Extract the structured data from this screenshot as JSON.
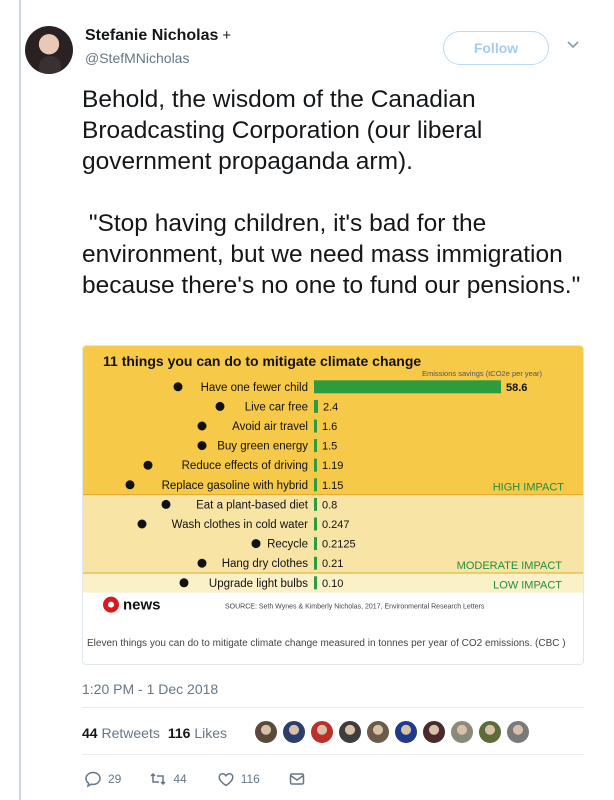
{
  "author": {
    "name": "Stefanie Nicholas",
    "name_symbol": "+",
    "handle": "@StefMNicholas"
  },
  "follow_label": "Follow",
  "tweet_text": "Behold, the wisdom of the Canadian Broadcasting Corporation (our liberal government propaganda arm).\n\n \"Stop having children, it's bad for the environment, but we need mass immigration because there's no one to fund our pensions.\"",
  "chart_data": {
    "type": "bar",
    "title": "11 things you can do to mitigate climate change",
    "subtitle": "Emissions savings (tCO2e per year)",
    "categories": [
      "Have one fewer child",
      "Live car free",
      "Avoid air travel",
      "Buy green energy",
      "Reduce effects of driving",
      "Replace gasoline with hybrid",
      "Eat a plant-based diet",
      "Wash clothes in cold water",
      "Recycle",
      "Hang dry clothes",
      "Upgrade light bulbs"
    ],
    "values": [
      58.6,
      2.4,
      1.6,
      1.5,
      1.19,
      1.15,
      0.8,
      0.247,
      0.2125,
      0.21,
      0.1
    ],
    "value_labels": [
      "58.6",
      "2.4",
      "1.6",
      "1.5",
      "1.19",
      "1.15",
      "0.8",
      "0.247",
      "0.2125",
      "0.21",
      "0.10"
    ],
    "groups": [
      {
        "label": "HIGH IMPACT",
        "count": 6
      },
      {
        "label": "MODERATE IMPACT",
        "count": 4
      },
      {
        "label": "LOW IMPACT",
        "count": 1
      }
    ],
    "brand": "news",
    "source": "SOURCE: Seth Wynes & Kimberly Nicholas, 2017, Environmental Research Letters",
    "colors": {
      "high": "#f7c948",
      "moderate": "#f8e5a6",
      "low": "#fbf1c8",
      "bar": "#2e9b3f",
      "group_label": "#1e8e3e",
      "brand": "#d71920"
    }
  },
  "card_caption": "Eleven things you can do to mitigate climate change measured in tonnes per year of CO2 emissions. (CBC )",
  "timestamp": "1:20 PM - 1 Dec 2018",
  "stats": {
    "retweets_count": "44",
    "retweets_label": "Retweets",
    "likes_count": "116",
    "likes_label": "Likes"
  },
  "liker_colors": [
    "#5a4a3a",
    "#2c3e6b",
    "#b8322a",
    "#3d3d3d",
    "#6b5c4a",
    "#1f3a8a",
    "#4a2a2a",
    "#8a8a7a",
    "#5b6b3a",
    "#7a7a7a"
  ],
  "actions": {
    "reply_count": "29",
    "retweet_count": "44",
    "like_count": "116"
  },
  "icons": {
    "verified_symbol": "plus",
    "caret": "chevron-down-icon",
    "reply": "reply-icon",
    "retweet": "retweet-icon",
    "like": "heart-icon",
    "dm": "message-icon"
  }
}
